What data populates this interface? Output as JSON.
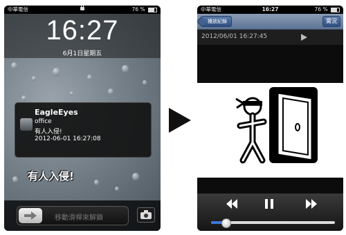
{
  "lock_screen": {
    "status": {
      "carrier": "中華電信",
      "battery": "76 %"
    },
    "time": "16:27",
    "date": "6月1日星期五",
    "notification": {
      "app": "EagleEyes",
      "line1": "office",
      "line2": "有人入侵!",
      "line3": "2012-06-01 16:27:08"
    },
    "overlay_text": "有人入侵!",
    "slide_text": "移動滑桿來解鎖"
  },
  "player_screen": {
    "status": {
      "carrier": "中華電信",
      "clock": "16:27",
      "battery": "76 %"
    },
    "nav": {
      "back_label": "播放紀錄",
      "right_label": "實況"
    },
    "timestamp": "2012/06/01 16:27:45",
    "playback_progress": 0.12
  },
  "colors": {
    "accent": "#3b78d8",
    "nav_bar": "#6f84a3"
  },
  "icons": [
    "arrow-right-icon",
    "camera-icon",
    "play-icon",
    "rewind-icon",
    "pause-icon",
    "fast-forward-icon",
    "intruder-icon",
    "door-icon"
  ]
}
